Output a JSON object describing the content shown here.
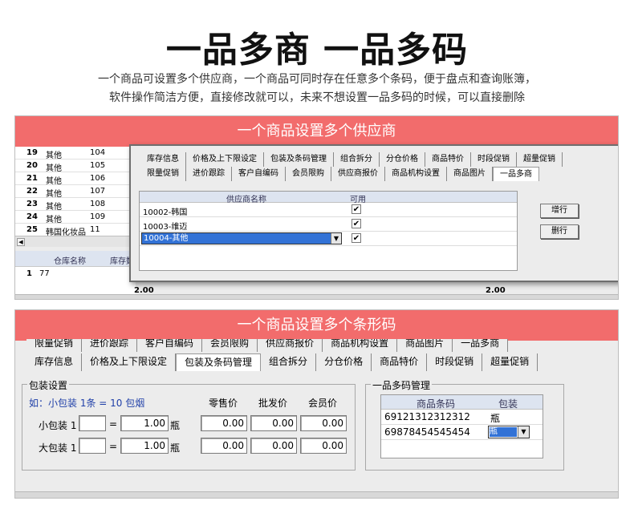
{
  "header": {
    "title": "一品多商 一品多码",
    "line1": "一个商品可设置多个供应商，一个商品可同时存在任意多个条码，便于盘点和查询账簿，",
    "line2": "软件操作简洁方便，直接修改就可以，未来不想设置一品多码的时候，可以直接删除"
  },
  "panel1": {
    "banner": "一个商品设置多个供应商",
    "back_rows": [
      {
        "num": "19",
        "name": "其他",
        "code": "104"
      },
      {
        "num": "20",
        "name": "其他",
        "code": "105"
      },
      {
        "num": "21",
        "name": "其他",
        "code": "106"
      },
      {
        "num": "22",
        "name": "其他",
        "code": "107"
      },
      {
        "num": "23",
        "name": "其他",
        "code": "108"
      },
      {
        "num": "24",
        "name": "其他",
        "code": "109"
      },
      {
        "num": "25",
        "name": "韩国化妆品",
        "code": "11"
      }
    ],
    "scroll_arrow": "◀",
    "lower_grid": {
      "col1": "仓库名称",
      "col2": "库存数",
      "row_num": "1",
      "row_val": "77"
    },
    "footer_value": "2.00",
    "tabs_row1": [
      "库存信息",
      "价格及上下限设定",
      "包装及条码管理",
      "组合拆分",
      "分仓价格",
      "商品特价",
      "时段促销",
      "超量促销"
    ],
    "tabs_row2": [
      "限量促销",
      "进价跟踪",
      "客户自编码",
      "会员限购",
      "供应商报价",
      "商品机构设置",
      "商品图片",
      "一品多商"
    ],
    "supplier_grid": {
      "col_name": "供应商名称",
      "col_enabled": "可用",
      "rows": [
        {
          "name": "10002-韩国",
          "checked": "✔"
        },
        {
          "name": "10003-维迈",
          "checked": "✔"
        },
        {
          "name": "10004-其他",
          "checked": "✔"
        }
      ]
    },
    "add_row": "增行",
    "delete_row": "删行"
  },
  "panel2": {
    "banner": "一个商品设置多个条形码",
    "tabs_row1": [
      "限量促销",
      "进价跟踪",
      "客户自编码",
      "会员限购",
      "供应商报价",
      "商品机构设置",
      "商品图片",
      "一品多商"
    ],
    "tabs_row2": [
      "库存信息",
      "价格及上下限设定",
      "包装及条码管理",
      "组合拆分",
      "分仓价格",
      "商品特价",
      "时段促销",
      "超量促销"
    ],
    "packaging": {
      "legend": "包装设置",
      "example": "如：小包装 1条 = 10 包烟",
      "col_retail": "零售价",
      "col_wholesale": "批发价",
      "col_member": "会员价",
      "small_label": "小包装 1",
      "large_label": "大包装 1",
      "eq": "=",
      "small_qty": "1.00",
      "large_qty": "1.00",
      "unit": "瓶",
      "small_prices": [
        "0.00",
        "0.00",
        "0.00"
      ],
      "large_prices": [
        "0.00",
        "0.00",
        "0.00"
      ]
    },
    "barcode": {
      "legend": "一品多码管理",
      "col_code": "商品条码",
      "col_pack": "包装",
      "rows": [
        {
          "code": "69121312312312",
          "pack": "瓶"
        },
        {
          "code": "69878454545454",
          "pack": "瓶"
        }
      ],
      "dropdown_arrow": "▼"
    }
  }
}
